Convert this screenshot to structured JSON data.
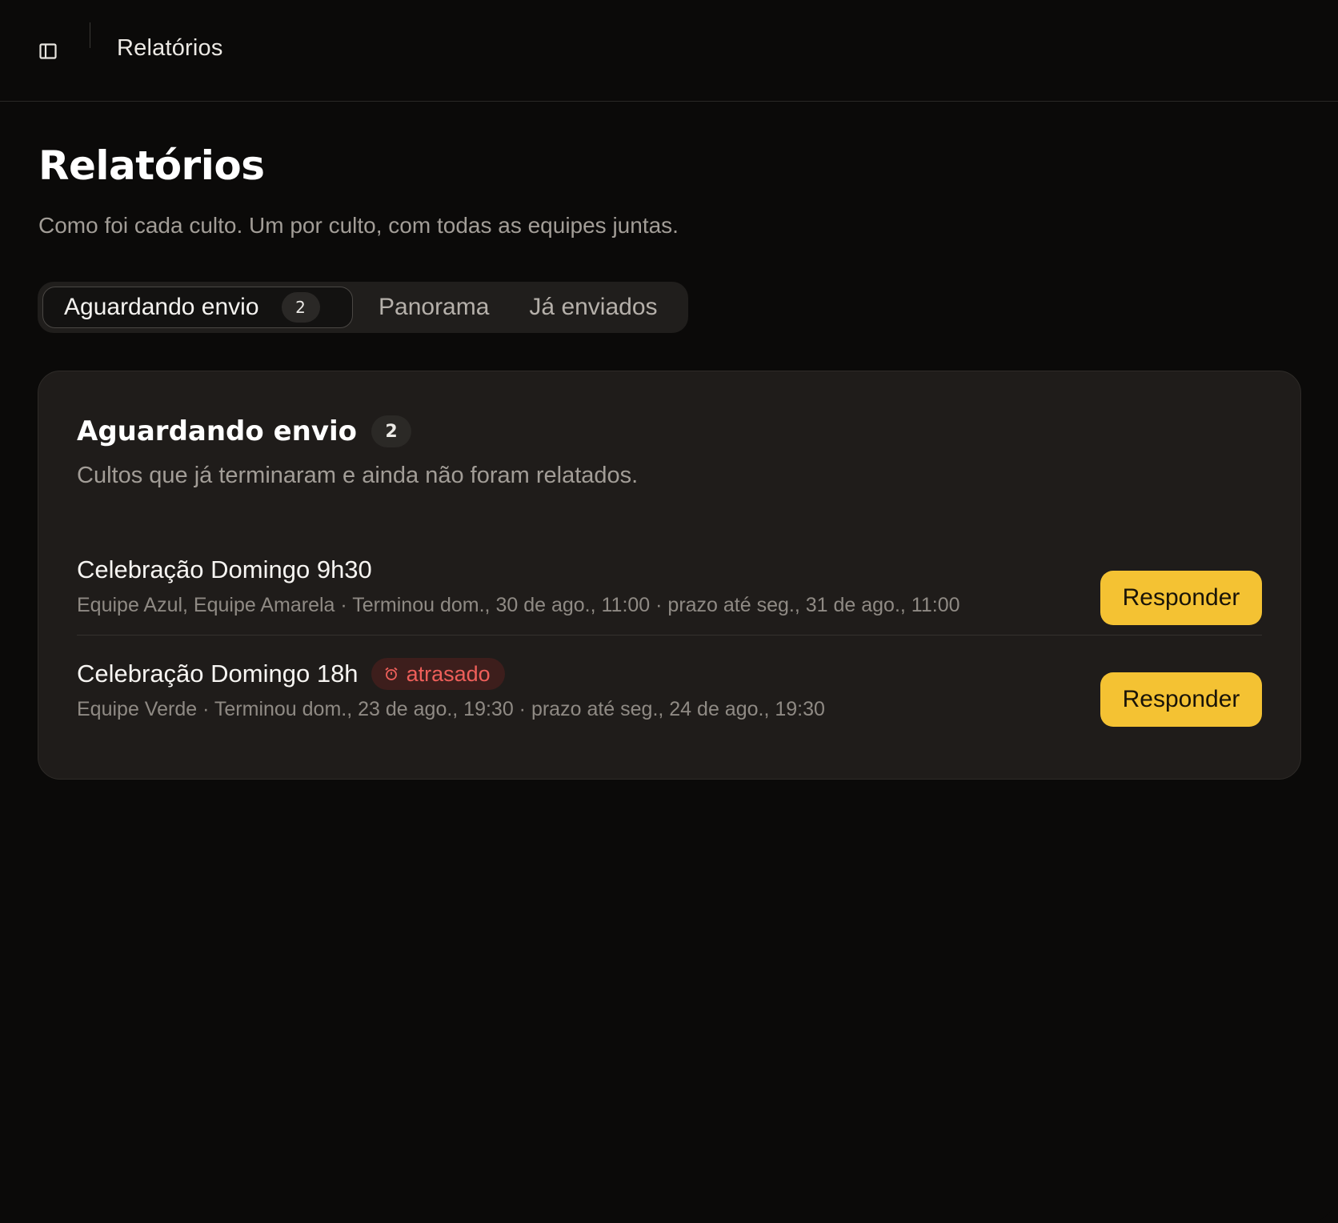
{
  "topbar": {
    "icon": "sidebar-toggle-icon",
    "title": "Relatórios"
  },
  "page": {
    "title": "Relatórios",
    "subtitle": "Como foi cada culto. Um por culto, com todas as equipes juntas."
  },
  "tabs": [
    {
      "label": "Aguardando envio",
      "badge": "2",
      "active": true
    },
    {
      "label": "Panorama",
      "active": false
    },
    {
      "label": "Já enviados",
      "active": false
    }
  ],
  "card": {
    "title": "Aguardando envio",
    "badge": "2",
    "subtitle": "Cultos que já terminaram e ainda não foram relatados.",
    "items": [
      {
        "title": "Celebração Domingo 9h30",
        "meta": "Equipe Azul, Equipe Amarela · Terminou dom., 30 de ago., 11:00 · prazo até seg., 31 de ago., 11:00",
        "action": "Responder"
      },
      {
        "title": "Celebração Domingo 18h",
        "status": {
          "label": "atrasado",
          "icon": "alarm-clock-icon",
          "color": "#ee5f5a"
        },
        "meta": "Equipe Verde · Terminou dom., 23 de ago., 19:30 · prazo até seg., 24 de ago., 19:30",
        "action": "Responder"
      }
    ]
  },
  "colors": {
    "background": "#0b0a09",
    "card": "#1f1c1a",
    "accent": "#f4c233",
    "danger": "#ee5f5a"
  }
}
